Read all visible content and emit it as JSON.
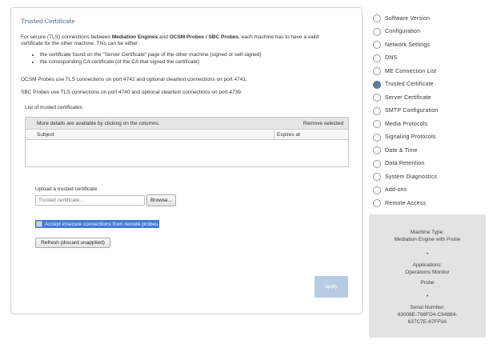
{
  "main": {
    "title": "Trusted Certificate",
    "intro_part1": "For secure (TLS) connections between ",
    "intro_bold1": "Mediation Engines",
    "intro_part2": " and ",
    "intro_bold2": "OCSM Probes / SBC Probes",
    "intro_part3": ", each machine has to have a valid",
    "intro_line2": "certificate for the other machine. This can be either:",
    "bullets": [
      "the certificate found on the \"Server Certificate\" page of the other machine (signed or self-signed)",
      "the corresponding CA certificate (of the CA that signed the certificate)"
    ],
    "ocsm_ports": "OCSM Probes use TLS connections on port 4742 and optional cleartext connections on port 4741.",
    "sbc_ports": "SBC Probes use TLS connections on port 4740 and optional cleartext connections on port 4739.",
    "list_label": "List of trusted certificates",
    "table_info": "More details are available by clicking on the columns.",
    "remove_label": "Remove selected",
    "columns": [
      "Subject",
      "Expires at"
    ],
    "upload_label": "Upload a trusted certificate",
    "upload_placeholder": "Trusted certificate...",
    "browse_label": "Browse...",
    "insecure_label": "Accept insecure connections from remote probes",
    "refresh_label": "Refresh (discard unapplied)",
    "apply_label": "apply"
  },
  "nav": {
    "items": [
      {
        "label": "Software Version",
        "active": false
      },
      {
        "label": "Configuration",
        "active": false
      },
      {
        "label": "Network Settings",
        "active": false
      },
      {
        "label": "DNS",
        "active": false
      },
      {
        "label": "ME Connection List",
        "active": false
      },
      {
        "label": "Trusted Certificate",
        "active": true
      },
      {
        "label": "Server Certificate",
        "active": false
      },
      {
        "label": "SMTP Configuration",
        "active": false
      },
      {
        "label": "Media Protocols",
        "active": false
      },
      {
        "label": "Signaling Protocols",
        "active": false
      },
      {
        "label": "Date & Time",
        "active": false
      },
      {
        "label": "Data Retention",
        "active": false
      },
      {
        "label": "System Diagnostics",
        "active": false
      },
      {
        "label": "Add-ons",
        "active": false
      },
      {
        "label": "Remote Access",
        "active": false
      }
    ]
  },
  "info": {
    "machine_type_label": "Machine Type:",
    "machine_type_value": "Mediation Engine with Probe",
    "sep1": "•",
    "applications_label": "Applications:",
    "app1": "Operations Monitor",
    "app2": "Probe",
    "sep2": "•",
    "serial_label": "Serial Number:",
    "serial_line1": "43008E-798FD4-C94884-",
    "serial_line2": "637C7E-87FF9A"
  },
  "colors": {
    "accent_title": "#3a5a86",
    "selection": "#3d7bd8",
    "active_radio": "#5d7f9e",
    "apply_button": "#b7cce2",
    "info_box": "#e3e3e3"
  }
}
